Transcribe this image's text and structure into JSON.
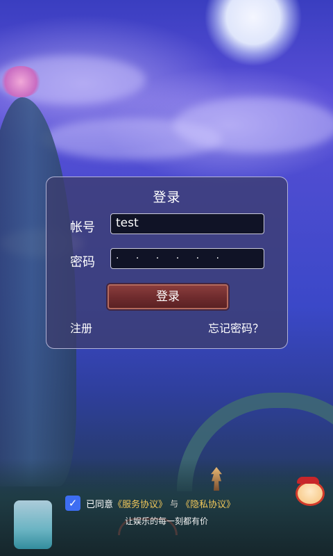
{
  "login": {
    "title": "登录",
    "account_label": "帐号",
    "account_value": "test",
    "password_label": "密码",
    "password_value": "· · · · · ·",
    "login_button": "登录",
    "register_link": "注册",
    "forgot_link": "忘记密码？"
  },
  "agreement": {
    "checked": true,
    "check_glyph": "✓",
    "prefix": "已同意",
    "service_link": "《服务协议》",
    "and": "与",
    "privacy_link": "《隐私协议》",
    "slogan": "让娱乐的每一刻都有价"
  },
  "colors": {
    "accent_blue": "#3d6df2",
    "link_gold": "#f2c85a",
    "button_red": "#6e2b2d"
  }
}
